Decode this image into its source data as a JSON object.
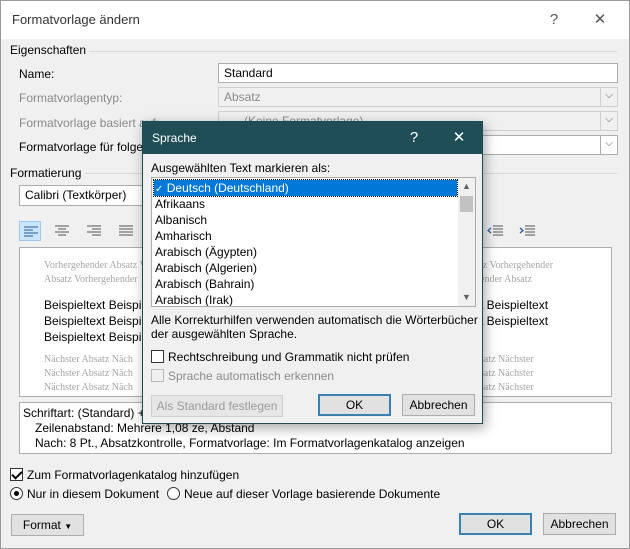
{
  "window": {
    "title": "Formatvorlage ändern",
    "help_glyph": "?",
    "close_glyph": "✕"
  },
  "properties": {
    "section_label": "Eigenschaften",
    "name_label": "Name:",
    "name_value": "Standard",
    "type_label": "Formatvorlagentyp:",
    "type_value": "Absatz",
    "based_on_label": "Formatvorlage basiert auf:",
    "based_on_value": "(Keine Formatvorlage)",
    "next_label": "Formatvorlage für folgen"
  },
  "formatting": {
    "section_label": "Formatierung",
    "font_value": "Calibri (Textkörper)"
  },
  "preview": {
    "prev_lines": [
      "Vorhergehender Absatz Vorhergehender Absatz",
      "Absatz Vorhergehender"
    ],
    "prev_right": [
      "tz Vorhergehender",
      "ender Absatz"
    ],
    "sample_left": [
      "Beispieltext Beispi",
      "Beispieltext Beispi",
      "Beispieltext Beispi"
    ],
    "sample_right": [
      "t Beispieltext",
      "t Beispieltext",
      ""
    ],
    "next_lines": [
      "Nächster Absatz Näch",
      "Nächster Absatz Näch",
      "Nächster Absatz Näch"
    ],
    "next_right": [
      "satz Nächster",
      "satz Nächster",
      "satz Nächster"
    ]
  },
  "description": {
    "line1": "Schriftart: (Standard) +T",
    "line2": "Zeilenabstand:  Mehrere 1,08 ze, Abstand",
    "line3": "Nach:  8 Pt., Absatzkontrolle, Formatvorlage: Im Formatvorlagenkatalog anzeigen"
  },
  "options": {
    "add_to_gallery": "Zum Formatvorlagenkatalog hinzufügen",
    "only_this_doc": "Nur in diesem Dokument",
    "new_docs": "Neue auf dieser Vorlage basierende Dokumente"
  },
  "footer": {
    "format_button": "Format",
    "ok_button": "OK",
    "cancel_button": "Abbrechen"
  },
  "language_dialog": {
    "title": "Sprache",
    "help_glyph": "?",
    "close_glyph": "✕",
    "list_label": "Ausgewählten Text markieren als:",
    "languages": [
      "Deutsch (Deutschland)",
      "Afrikaans",
      "Albanisch",
      "Amharisch",
      "Arabisch (Ägypten)",
      "Arabisch (Algerien)",
      "Arabisch (Bahrain)",
      "Arabisch (Irak)"
    ],
    "info_line1": "Alle Korrekturhilfen verwenden automatisch die Wörterbücher",
    "info_line2": "der ausgewählten Sprache.",
    "no_proofing": "Rechtschreibung und Grammatik nicht prüfen",
    "auto_detect": "Sprache automatisch erkennen",
    "set_default_button": "Als Standard festlegen",
    "ok_button": "OK",
    "cancel_button": "Abbrechen"
  },
  "colors": {
    "dialog_title_bg": "#1f4e57",
    "selection": "#0078d7",
    "primary_button_border": "#3c7fb1"
  }
}
